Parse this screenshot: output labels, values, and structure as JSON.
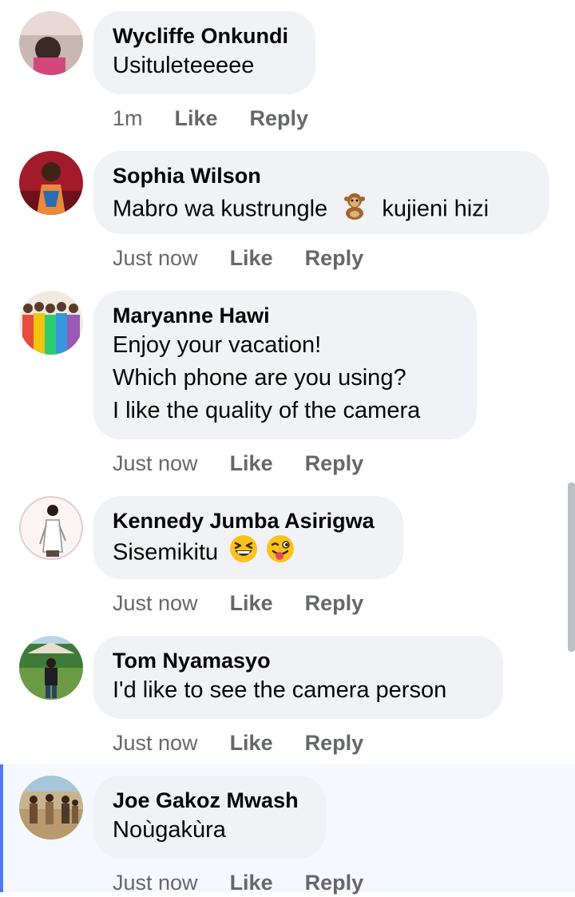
{
  "comments": [
    {
      "name": "Wycliffe Onkundi",
      "lines": [
        "Usituleteeeee"
      ],
      "time": "1m",
      "like": "Like",
      "reply": "Reply"
    },
    {
      "name": "Sophia Wilson",
      "text_before": "Mabro wa kustrungle",
      "emoji": "monkey-emoji",
      "text_after": "kujieni hizi",
      "time": "Just now",
      "like": "Like",
      "reply": "Reply"
    },
    {
      "name": "Maryanne Hawi",
      "lines": [
        "Enjoy your vacation!",
        "Which phone are you using?",
        "I like the quality of the camera"
      ],
      "time": "Just now",
      "like": "Like",
      "reply": "Reply"
    },
    {
      "name": "Kennedy Jumba Asirigwa",
      "text": "Sisemikitu",
      "emojis": [
        "laughing-squint-emoji",
        "winking-tongue-emoji"
      ],
      "time": "Just now",
      "like": "Like",
      "reply": "Reply"
    },
    {
      "name": "Tom Nyamasyo",
      "lines": [
        "I'd like to see the camera person"
      ],
      "time": "Just now",
      "like": "Like",
      "reply": "Reply"
    },
    {
      "name": "Joe Gakoz Mwash",
      "lines": [
        "Noùgakùra"
      ],
      "time": "Just now",
      "like": "Like",
      "reply": "Reply"
    }
  ],
  "colors": {
    "bubble": "#f0f2f5",
    "meta_text": "#65676b",
    "highlight_bg": "#f5f8fe",
    "highlight_bar": "#4b7bec"
  }
}
